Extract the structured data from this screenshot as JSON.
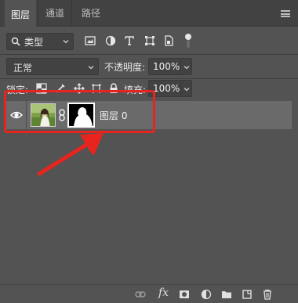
{
  "tabs": [
    {
      "label": "图层",
      "active": true
    },
    {
      "label": "通道",
      "active": false
    },
    {
      "label": "路径",
      "active": false
    }
  ],
  "filter": {
    "label": "类型",
    "icons": [
      "image-filter-icon",
      "adjustment-filter-icon",
      "type-filter-icon",
      "shape-filter-icon",
      "smart-object-filter-icon",
      "filter-toggle-icon"
    ]
  },
  "blend": {
    "mode": "正常",
    "opacity_label": "不透明度:",
    "opacity_value": "100%"
  },
  "lock": {
    "label": "锁定:",
    "fill_label": "填充:",
    "fill_value": "100%"
  },
  "layer": {
    "name": "图层 0",
    "visible": true
  },
  "bottom_icons": [
    "link-layers-icon",
    "fx-icon",
    "add-mask-icon",
    "adjustment-layer-icon",
    "new-group-icon",
    "new-layer-icon",
    "trash-icon"
  ],
  "fx_label": "fx",
  "colors": {
    "panel": "#535353",
    "highlight": "#e8241e",
    "selected_row": "#6a6a6a"
  }
}
